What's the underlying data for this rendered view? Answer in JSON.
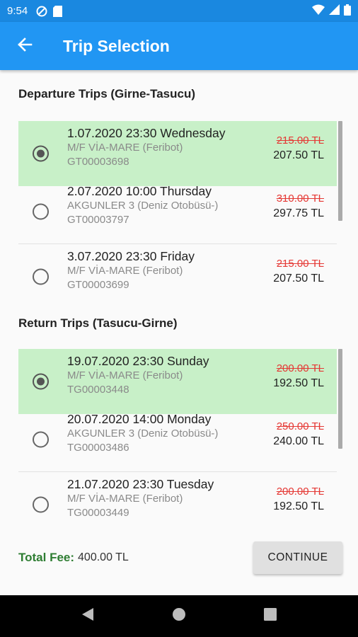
{
  "status_bar": {
    "time": "9:54"
  },
  "app_bar": {
    "title": "Trip Selection"
  },
  "departure": {
    "title": "Departure Trips (Girne-Tasucu)",
    "trips": [
      {
        "date": "1.07.2020 23:30 Wednesday",
        "vessel": "M/F VİA-MARE (Feribot)",
        "code": "GT00003698",
        "old_price": "215.00 TL",
        "price": "207.50 TL",
        "selected": true
      },
      {
        "date": "2.07.2020 10:00 Thursday",
        "vessel": "AKGUNLER 3 (Deniz Otobüsü-)",
        "code": "GT00003797",
        "old_price": "310.00 TL",
        "price": "297.75 TL",
        "selected": false
      },
      {
        "date": "3.07.2020 23:30 Friday",
        "vessel": "M/F VİA-MARE (Feribot)",
        "code": "GT00003699",
        "old_price": "215.00 TL",
        "price": "207.50 TL",
        "selected": false
      }
    ]
  },
  "return": {
    "title": "Return Trips (Tasucu-Girne)",
    "trips": [
      {
        "date": "19.07.2020 23:30 Sunday",
        "vessel": "M/F VİA-MARE (Feribot)",
        "code": "TG00003448",
        "old_price": "200.00 TL",
        "price": "192.50 TL",
        "selected": true
      },
      {
        "date": "20.07.2020 14:00 Monday",
        "vessel": "AKGUNLER 3 (Deniz Otobüsü-)",
        "code": "TG00003486",
        "old_price": "250.00 TL",
        "price": "240.00 TL",
        "selected": false
      },
      {
        "date": "21.07.2020 23:30 Tuesday",
        "vessel": "M/F VİA-MARE (Feribot)",
        "code": "TG00003449",
        "old_price": "200.00 TL",
        "price": "192.50 TL",
        "selected": false
      }
    ]
  },
  "footer": {
    "total_label": "Total Fee:",
    "total_value": "400.00 TL",
    "continue_label": "CONTINUE"
  },
  "colors": {
    "app_bar": "#2196f3",
    "status_bar": "#1a88e0",
    "selected_row": "#c8f0c8",
    "old_price": "#e53935",
    "total_label": "#2e7d32"
  },
  "icons": {
    "back": "arrow-left-icon",
    "nav_back": "triangle-back-icon",
    "nav_home": "circle-home-icon",
    "nav_recents": "square-recents-icon"
  }
}
